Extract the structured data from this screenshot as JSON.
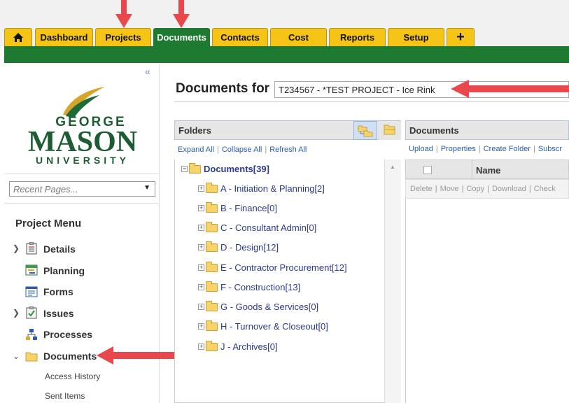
{
  "nav": {
    "home_icon": "home-icon",
    "tabs": [
      {
        "label": "Dashboard"
      },
      {
        "label": "Projects"
      },
      {
        "label": "Documents"
      },
      {
        "label": "Contacts"
      },
      {
        "label": "Cost"
      },
      {
        "label": "Reports"
      },
      {
        "label": "Setup"
      },
      {
        "label": "+"
      }
    ],
    "active_tab": "Documents",
    "colors": {
      "tab": "#f6c417",
      "active": "#1e7a30",
      "bar": "#1e7a30"
    }
  },
  "sidebar": {
    "logo": {
      "line1": "GEORGE",
      "line2": "MASON",
      "line3": "UNIVERSITY"
    },
    "recent_pages_placeholder": "Recent Pages...",
    "menu_title": "Project Menu",
    "items": [
      {
        "label": "Details",
        "icon": "clipboard-icon",
        "expandable": true
      },
      {
        "label": "Planning",
        "icon": "planning-icon",
        "expandable": false
      },
      {
        "label": "Forms",
        "icon": "forms-icon",
        "expandable": false
      },
      {
        "label": "Issues",
        "icon": "issues-icon",
        "expandable": true
      },
      {
        "label": "Processes",
        "icon": "processes-icon",
        "expandable": false
      },
      {
        "label": "Documents",
        "icon": "folder-icon",
        "expandable": true,
        "expanded": true
      }
    ],
    "subitems": [
      {
        "label": "Access History"
      },
      {
        "label": "Sent Items"
      }
    ]
  },
  "main": {
    "title": "Documents for",
    "project_select": "T234567 - *TEST PROJECT - Ice Rink"
  },
  "folders_panel": {
    "title": "Folders",
    "links": [
      "Expand All",
      "Collapse All",
      "Refresh All"
    ],
    "root": "Documents[39]",
    "folders": [
      "A - Initiation & Planning[2]",
      "B - Finance[0]",
      "C - Consultant Admin[0]",
      "D - Design[12]",
      "E - Contractor Procurement[12]",
      "F - Construction[13]",
      "G - Goods & Services[0]",
      "H - Turnover & Closeout[0]",
      "J - Archives[0]"
    ]
  },
  "documents_panel": {
    "title": "Documents",
    "links": [
      "Upload",
      "Properties",
      "Create Folder",
      "Subscr"
    ],
    "column_name": "Name",
    "actions": [
      "Delete",
      "Move",
      "Copy",
      "Download",
      "Check"
    ]
  }
}
